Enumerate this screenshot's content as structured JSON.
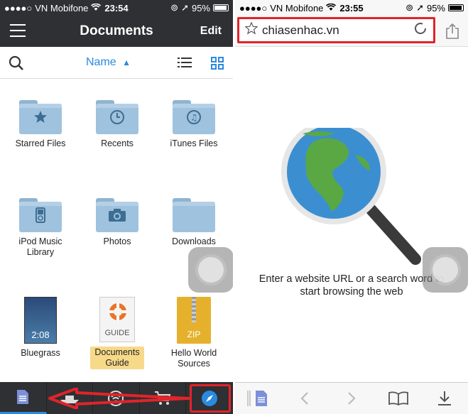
{
  "left_screen": {
    "status": {
      "carrier": "VN Mobifone",
      "time": "23:54",
      "battery": "95%"
    },
    "nav": {
      "title": "Documents",
      "edit_label": "Edit"
    },
    "sort": {
      "label": "Name"
    },
    "items": [
      {
        "label": "Starred Files",
        "icon": "star-folder-icon"
      },
      {
        "label": "Recents",
        "icon": "clock-folder-icon"
      },
      {
        "label": "iTunes Files",
        "icon": "music-folder-icon"
      },
      {
        "label_line1": "iPod Music",
        "label_line2": "Library",
        "icon": "ipod-folder-icon"
      },
      {
        "label": "Photos",
        "icon": "camera-folder-icon"
      },
      {
        "label": "Downloads",
        "icon": "folder-icon"
      },
      {
        "label": "Bluegrass",
        "thumb_text": "2:08",
        "icon": "video-thumbnail"
      },
      {
        "label_line1": "Documents",
        "label_line2": "Guide",
        "thumb_text": "GUIDE",
        "icon": "lifebuoy-icon"
      },
      {
        "label_line1": "Hello World",
        "label_line2": "Sources",
        "thumb_text": "ZIP",
        "icon": "zip-icon"
      }
    ],
    "tabs": [
      "documents-tab-icon",
      "ferry-icon",
      "wifi-transfer-icon",
      "cart-icon",
      "compass-icon"
    ]
  },
  "right_screen": {
    "status": {
      "carrier": "VN Mobifone",
      "time": "23:55",
      "battery": "95%"
    },
    "url": "chiasenhac.vn",
    "hint_line1": "Enter a website URL or a search word to",
    "hint_line2": "start browsing the web"
  },
  "colors": {
    "accent": "#2a8ae0",
    "dark_bar": "#2f3033",
    "highlight_red": "#e0242a",
    "folder_blue": "#9fc2de"
  }
}
